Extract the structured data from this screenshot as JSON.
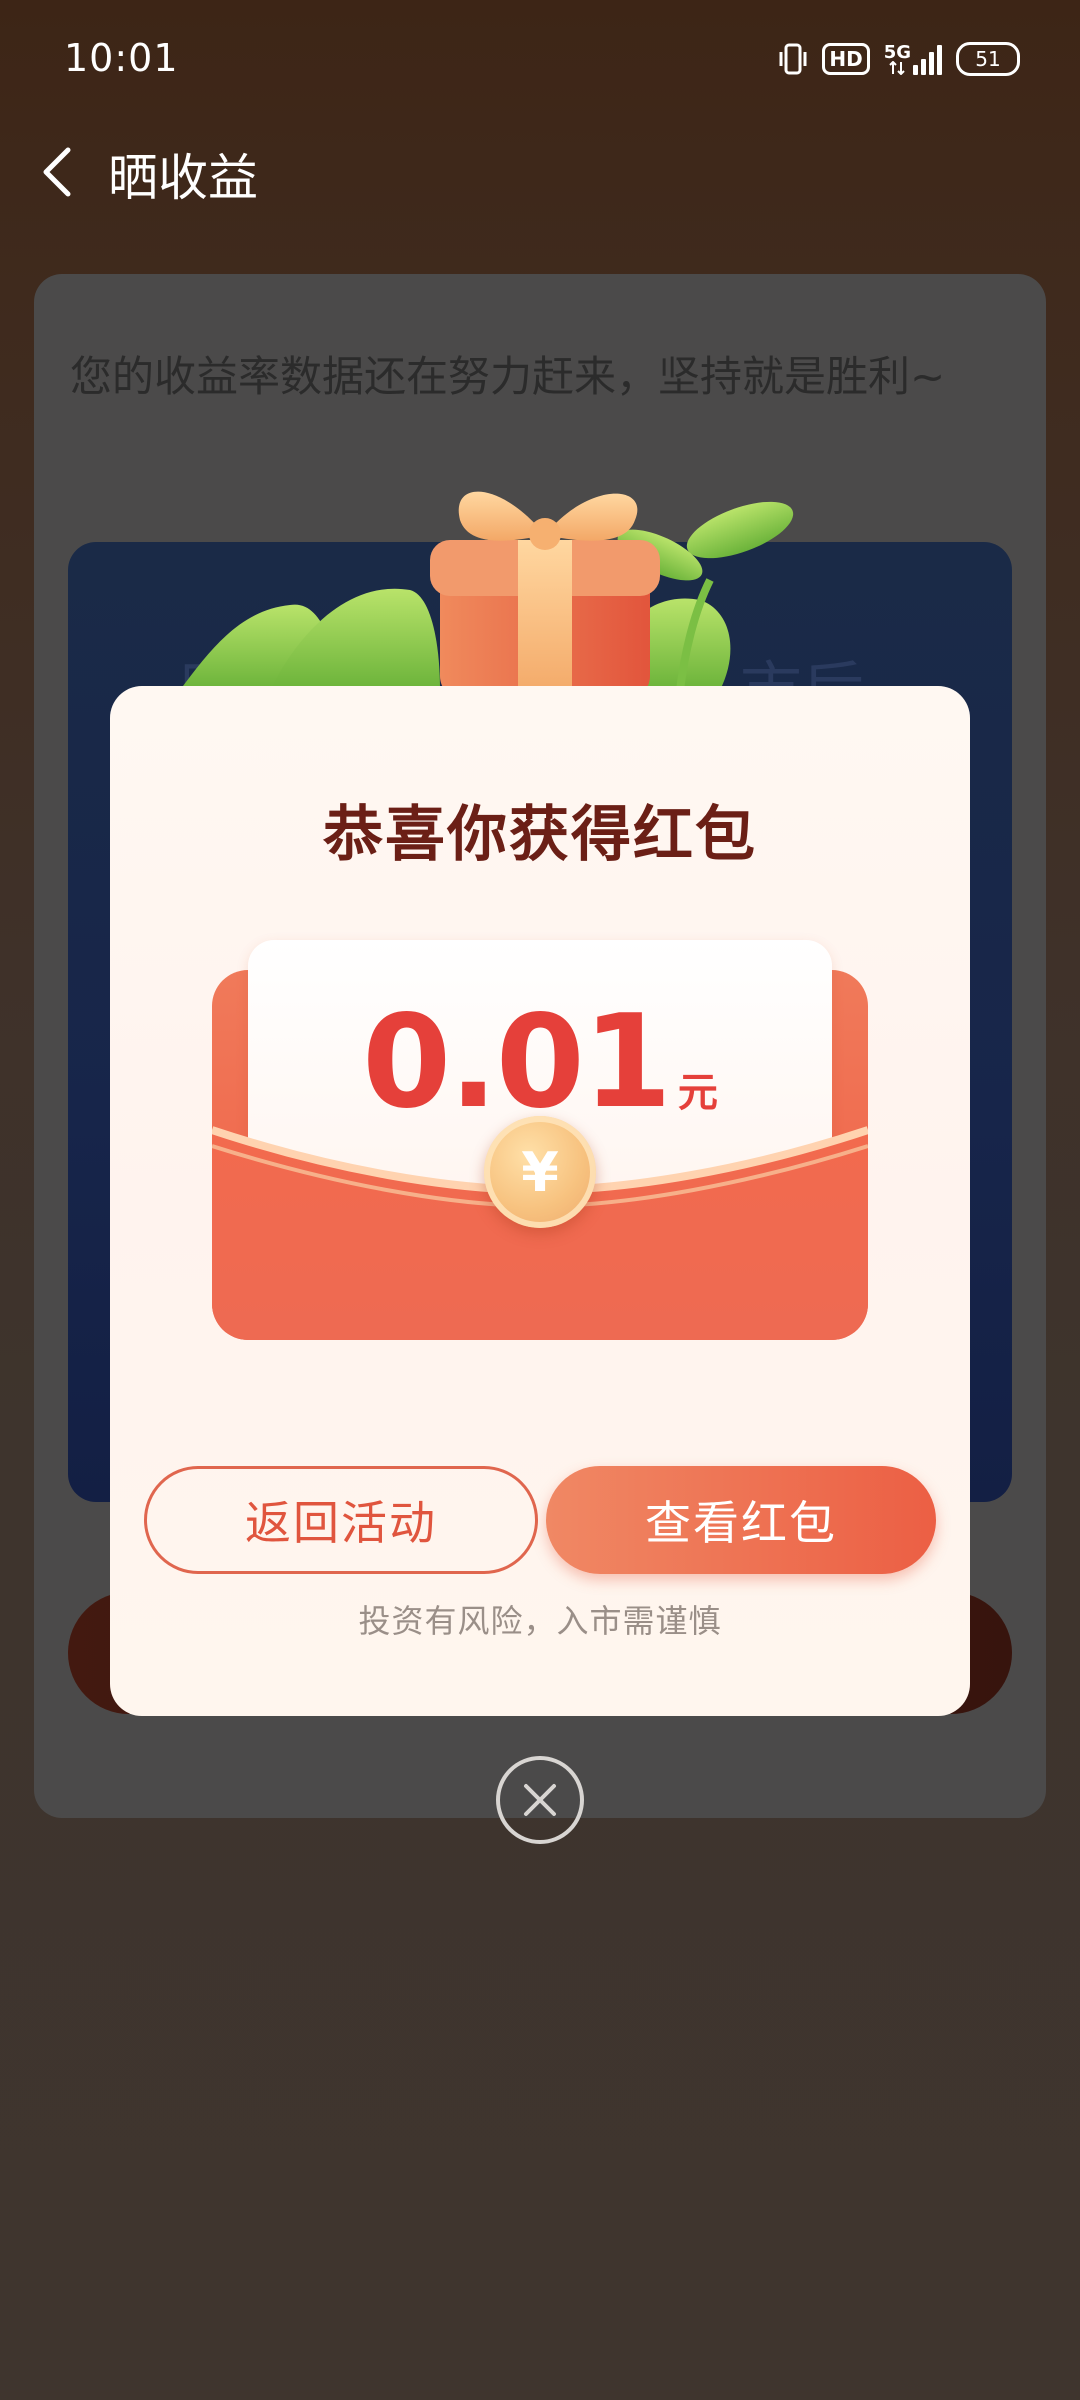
{
  "status_bar": {
    "time": "10:01",
    "hd_label": "HD",
    "network": "5G",
    "battery": "51"
  },
  "nav": {
    "title": "晒收益"
  },
  "background": {
    "message": "您的收益率数据还在努力赶来，坚持就是胜利~",
    "word_left": "晚",
    "word_right": "市后"
  },
  "modal": {
    "title": "恭喜你获得红包",
    "amount": "0.01",
    "unit": "元",
    "coin_symbol": "¥",
    "return_button": "返回活动",
    "view_button": "查看红包",
    "risk_note": "投资有风险，入市需谨慎"
  },
  "colors": {
    "brand_red": "#e5403a",
    "title_brown": "#6b1f16",
    "button_gradient_start": "#f08864",
    "button_gradient_end": "#ec5f44"
  }
}
